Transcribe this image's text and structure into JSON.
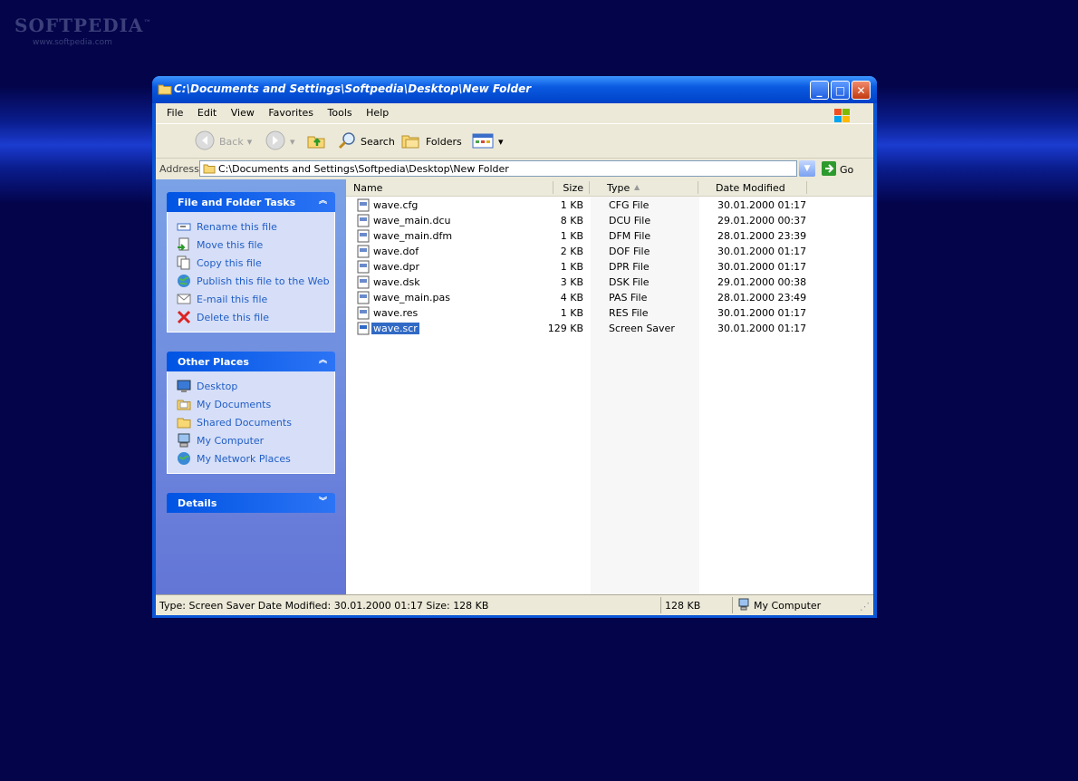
{
  "watermark": {
    "brand": "SOFTPEDIA",
    "tm": "™",
    "url": "www.softpedia.com"
  },
  "window": {
    "title": "C:\\Documents and Settings\\Softpedia\\Desktop\\New Folder",
    "buttons": {
      "minimize": "_",
      "maximize": "□",
      "close": "✕"
    }
  },
  "menu": [
    "File",
    "Edit",
    "View",
    "Favorites",
    "Tools",
    "Help"
  ],
  "toolbar": {
    "back": "Back",
    "search": "Search",
    "folders": "Folders"
  },
  "address": {
    "label": "Address",
    "path": "C:\\Documents and Settings\\Softpedia\\Desktop\\New Folder",
    "go": "Go"
  },
  "tasks": {
    "title": "File and Folder Tasks",
    "items": [
      "Rename this file",
      "Move this file",
      "Copy this file",
      "Publish this file to the Web",
      "E-mail this file",
      "Delete this file"
    ]
  },
  "places": {
    "title": "Other Places",
    "items": [
      "Desktop",
      "My Documents",
      "Shared Documents",
      "My Computer",
      "My Network Places"
    ]
  },
  "details": {
    "title": "Details"
  },
  "columns": {
    "name": "Name",
    "size": "Size",
    "type": "Type",
    "date": "Date Modified"
  },
  "files": [
    {
      "name": "wave.cfg",
      "size": "1 KB",
      "type": "CFG File",
      "date": "30.01.2000 01:17"
    },
    {
      "name": "wave_main.dcu",
      "size": "8 KB",
      "type": "DCU File",
      "date": "29.01.2000 00:37"
    },
    {
      "name": "wave_main.dfm",
      "size": "1 KB",
      "type": "DFM File",
      "date": "28.01.2000 23:39"
    },
    {
      "name": "wave.dof",
      "size": "2 KB",
      "type": "DOF File",
      "date": "30.01.2000 01:17"
    },
    {
      "name": "wave.dpr",
      "size": "1 KB",
      "type": "DPR File",
      "date": "30.01.2000 01:17"
    },
    {
      "name": "wave.dsk",
      "size": "3 KB",
      "type": "DSK File",
      "date": "29.01.2000 00:38"
    },
    {
      "name": "wave_main.pas",
      "size": "4 KB",
      "type": "PAS File",
      "date": "28.01.2000 23:49"
    },
    {
      "name": "wave.res",
      "size": "1 KB",
      "type": "RES File",
      "date": "30.01.2000 01:17"
    },
    {
      "name": "wave.scr",
      "size": "129 KB",
      "type": "Screen Saver",
      "date": "30.01.2000 01:17"
    }
  ],
  "selected_file": "wave.scr",
  "status": {
    "info": "Type: Screen Saver Date Modified: 30.01.2000 01:17 Size: 128 KB",
    "size": "128 KB",
    "zone": "My Computer"
  },
  "icons": {
    "window": "folder-icon",
    "back": "back-arrow-icon",
    "forward": "forward-arrow-icon",
    "up": "up-folder-icon",
    "search": "search-icon",
    "folders": "folders-icon",
    "views": "views-icon",
    "go": "go-arrow-icon",
    "task_icons": [
      "rename-icon",
      "move-icon",
      "copy-icon",
      "publish-icon",
      "email-icon",
      "delete-icon"
    ],
    "place_icons": [
      "desktop-icon",
      "my-documents-icon",
      "shared-documents-icon",
      "my-computer-icon",
      "network-places-icon"
    ]
  },
  "colors": {
    "desktop": "#03044a",
    "titlebar": "#0a56d6",
    "taskpane": "#6f8ee0",
    "link": "#215dc6",
    "selection": "#316ac5"
  }
}
